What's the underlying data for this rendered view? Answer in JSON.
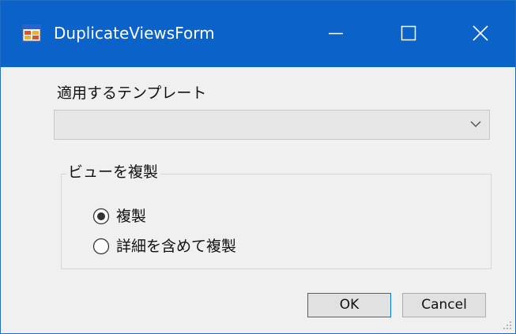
{
  "window": {
    "title": "DuplicateViewsForm",
    "controls": {
      "minimize_icon": "minimize-icon",
      "maximize_icon": "maximize-icon",
      "close_icon": "close-icon"
    },
    "titlebar_color": "#0b63c9"
  },
  "template": {
    "label": "適用するテンプレート",
    "selected_value": ""
  },
  "duplicate_group": {
    "legend": "ビューを複製",
    "options": [
      {
        "label": "複製",
        "checked": true
      },
      {
        "label": "詳細を含めて複製",
        "checked": false
      }
    ]
  },
  "buttons": {
    "ok_label": "OK",
    "cancel_label": "Cancel"
  }
}
